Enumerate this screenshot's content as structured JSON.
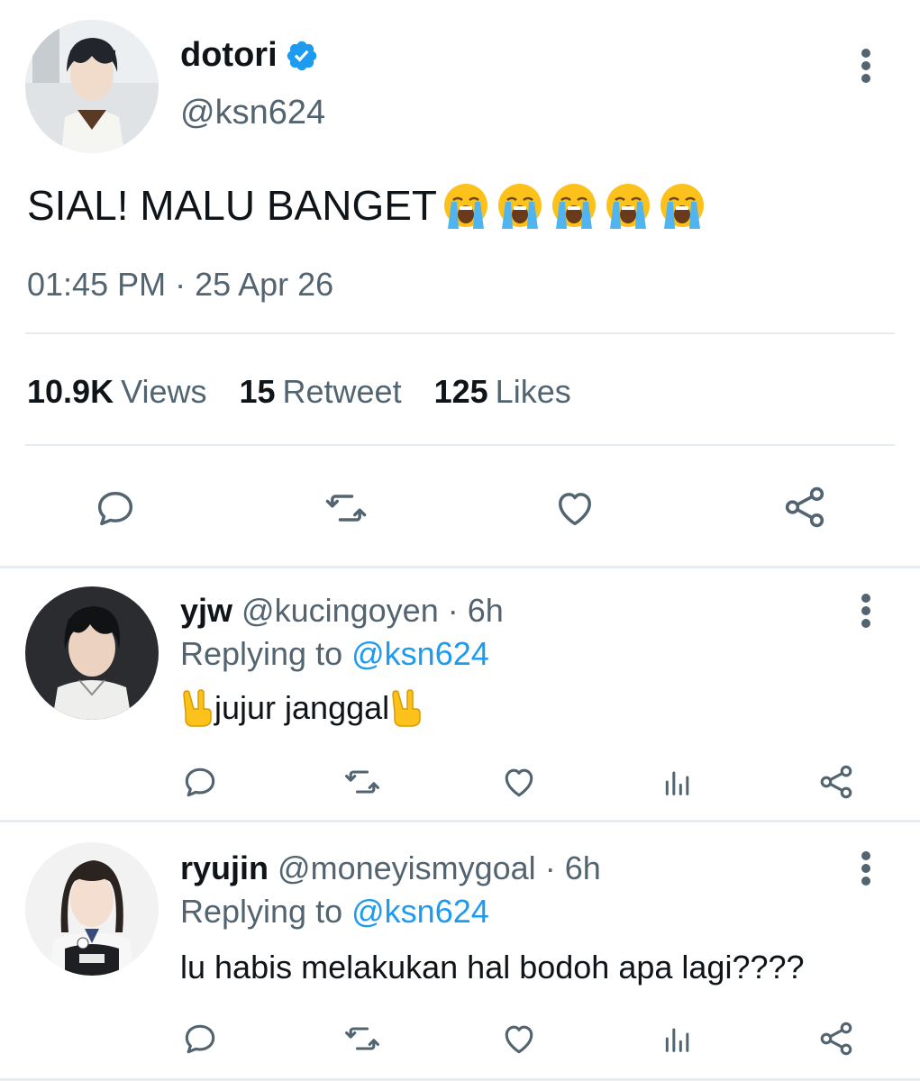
{
  "main_tweet": {
    "name": "dotori",
    "handle": "@ksn624",
    "text": "SIAL! MALU BANGET",
    "emoji_count": 5,
    "timestamp": "01:45 PM · 25 Apr 26",
    "stats": [
      {
        "number": "10.9K",
        "label": "Views"
      },
      {
        "number": "15",
        "label": "Retweet"
      },
      {
        "number": "125",
        "label": "Likes"
      }
    ],
    "verified": true
  },
  "icons": {
    "reply": "reply-icon",
    "retweet": "retweet-icon",
    "like": "heart-icon",
    "share": "share-icon",
    "analytics": "analytics-icon",
    "more": "more-vertical-icon"
  },
  "colors": {
    "text_primary": "#0f1419",
    "text_secondary": "#536471",
    "link": "#1d9bf0",
    "verified": "#1d9bf0",
    "divider": "#e6ecf0"
  },
  "replies": [
    {
      "name": "yjw",
      "handle": "@kucingoyen",
      "time": "6h",
      "replying_label": "Replying to",
      "replying_to": "@ksn624",
      "text": "jujur janggal"
    },
    {
      "name": "ryujin",
      "handle": "@moneyismygoal",
      "time": "6h",
      "replying_label": "Replying to",
      "replying_to": "@ksn624",
      "text": "lu habis melakukan hal bodoh apa lagi????"
    }
  ]
}
